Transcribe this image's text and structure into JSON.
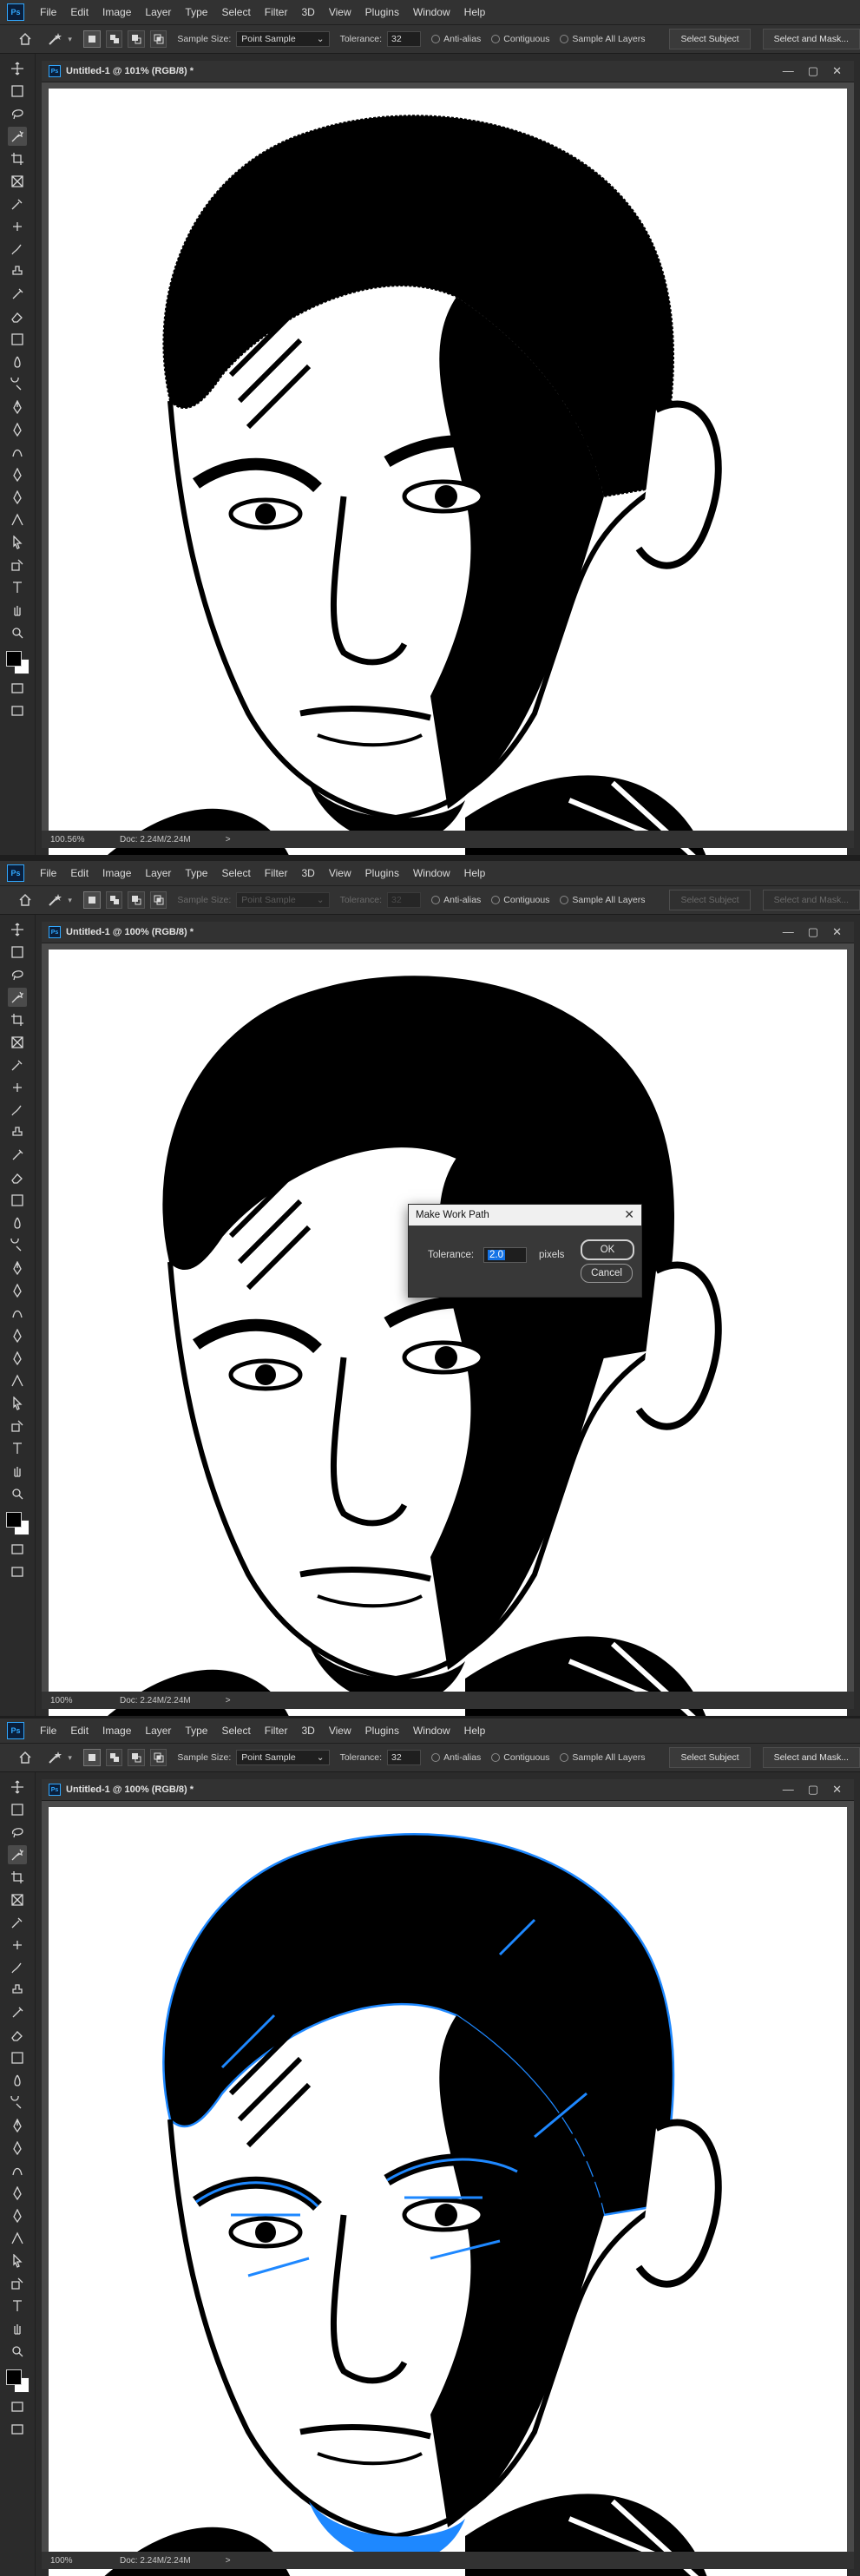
{
  "menu": [
    "File",
    "Edit",
    "Image",
    "Layer",
    "Type",
    "Select",
    "Filter",
    "3D",
    "View",
    "Plugins",
    "Window",
    "Help"
  ],
  "app_icon": "Ps",
  "options": {
    "sample_size_label": "Sample Size:",
    "sample_size_value": "Point Sample",
    "tolerance_label": "Tolerance:",
    "tolerance_value": "32",
    "anti_alias": "Anti-alias",
    "contiguous": "Contiguous",
    "sample_all_layers": "Sample All Layers",
    "select_subject": "Select Subject",
    "select_and_mask": "Select and Mask..."
  },
  "panels": [
    {
      "doc_title": "Untitled-1 @ 101% (RGB/8) *",
      "zoom": "100.56%",
      "doc_info": "Doc: 2.24M/2.24M",
      "state": "selection"
    },
    {
      "doc_title": "Untitled-1 @ 100% (RGB/8) *",
      "zoom": "100%",
      "doc_info": "Doc: 2.24M/2.24M",
      "state": "dialog"
    },
    {
      "doc_title": "Untitled-1 @ 100% (RGB/8) *",
      "zoom": "100%",
      "doc_info": "Doc: 2.24M/2.24M",
      "state": "path"
    }
  ],
  "dialog": {
    "title": "Make Work Path",
    "tolerance_label": "Tolerance:",
    "tolerance_value": "2.0",
    "unit": "pixels",
    "ok": "OK",
    "cancel": "Cancel"
  },
  "status_arrow": ">",
  "window_controls": [
    "—",
    "▢",
    "✕"
  ],
  "colors": {
    "path_blue": "#1e88ff",
    "selection": "#000000",
    "accent": "#31a8ff"
  }
}
